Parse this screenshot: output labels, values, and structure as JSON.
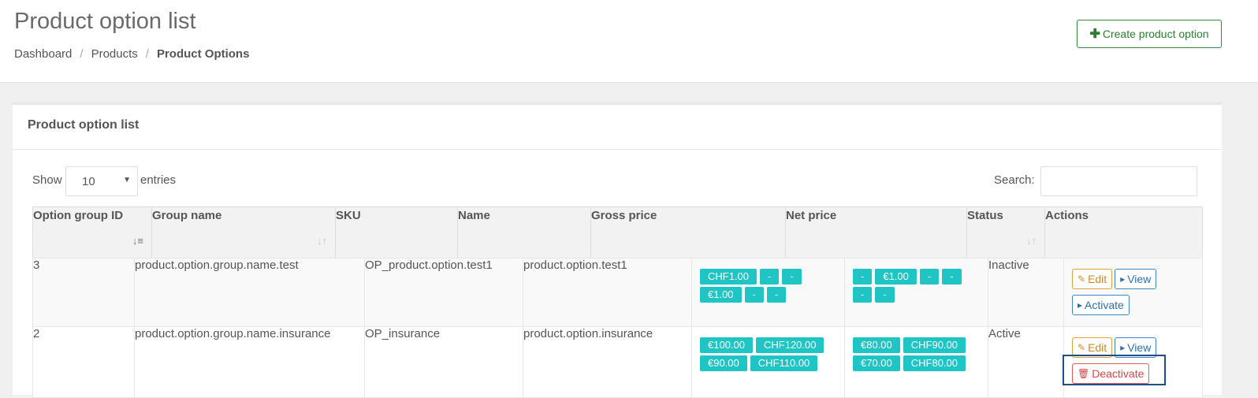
{
  "header": {
    "title": "Product option list",
    "breadcrumb": [
      "Dashboard",
      "Products",
      "Product Options"
    ],
    "breadcrumb_sep": "/",
    "create_button": "Create product option"
  },
  "panel": {
    "title": "Product option list",
    "show_label": "Show",
    "page_length": "10",
    "entries_label": "entries",
    "search_label": "Search:",
    "search_value": ""
  },
  "table": {
    "columns": [
      "Option group ID",
      "Group name",
      "SKU",
      "Name",
      "Gross price",
      "Net price",
      "Status",
      "Actions"
    ],
    "rows": [
      {
        "id": "3",
        "group_name": "product.option.group.name.test",
        "sku": "OP_product.option.test1",
        "name": "product.option.test1",
        "gross_price": [
          "CHF1.00",
          "-",
          "-",
          "€1.00",
          "-",
          "-"
        ],
        "net_price": [
          "-",
          "€1.00",
          "-",
          "-",
          "-",
          "-"
        ],
        "status": "Inactive",
        "actions": [
          "Edit",
          "View",
          "Activate"
        ]
      },
      {
        "id": "2",
        "group_name": "product.option.group.name.insurance",
        "sku": "OP_insurance",
        "name": "product.option.insurance",
        "gross_price": [
          "€100.00",
          "CHF120.00",
          "€90.00",
          "CHF110.00"
        ],
        "net_price": [
          "€80.00",
          "CHF90.00",
          "€70.00",
          "CHF80.00"
        ],
        "status": "Active",
        "actions": [
          "Edit",
          "View",
          "Deactivate"
        ]
      }
    ]
  },
  "colors": {
    "tag": "#1fc4c4",
    "inactive": "#e05a5a",
    "active": "#2a7ab8",
    "edit": "#d08a22",
    "view": "#2a6fb0",
    "create": "#2e7d32"
  },
  "icons": {
    "create": "plus-icon",
    "edit": "edit-icon",
    "view": "caret-right-icon",
    "activate": "caret-right-icon",
    "deactivate": "trash-icon",
    "select": "caret-down-icon",
    "sort": "sort-icon"
  }
}
